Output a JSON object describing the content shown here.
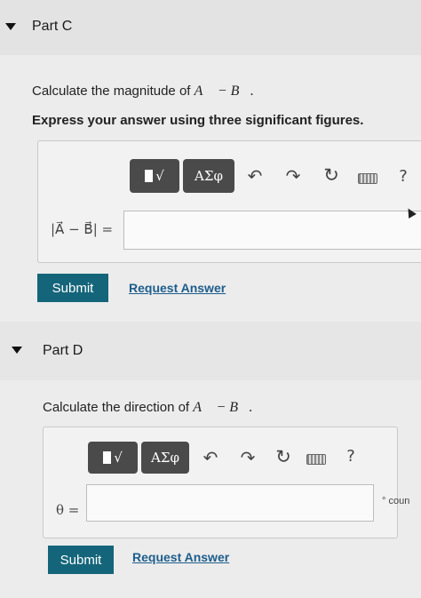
{
  "part_c": {
    "title": "Part C",
    "question": "Calculate the magnitude of",
    "question_expr": "A⃗ − B⃗.",
    "instruction": "Express your answer using three significant figures.",
    "greek_label": "ΑΣφ",
    "help_label": "?",
    "equation_label": "|A⃗ − B⃗| =",
    "input_value": "",
    "submit_label": "Submit",
    "request_answer_label": "Request Answer"
  },
  "part_d": {
    "title": "Part D",
    "question": "Calculate the direction of",
    "question_expr": "A⃗ − B⃗.",
    "greek_label": "ΑΣφ",
    "help_label": "?",
    "equation_label": "θ =",
    "input_value": "",
    "unit_text": "° coun",
    "submit_label": "Submit",
    "request_answer_label": "Request Answer"
  },
  "icons": {
    "undo": "↶",
    "redo": "↷",
    "reset": "↻",
    "templates_radical": "√"
  },
  "colors": {
    "submit_button": "#14657a",
    "link": "#1d5d8c",
    "toolbar": "#4a4a4a"
  }
}
